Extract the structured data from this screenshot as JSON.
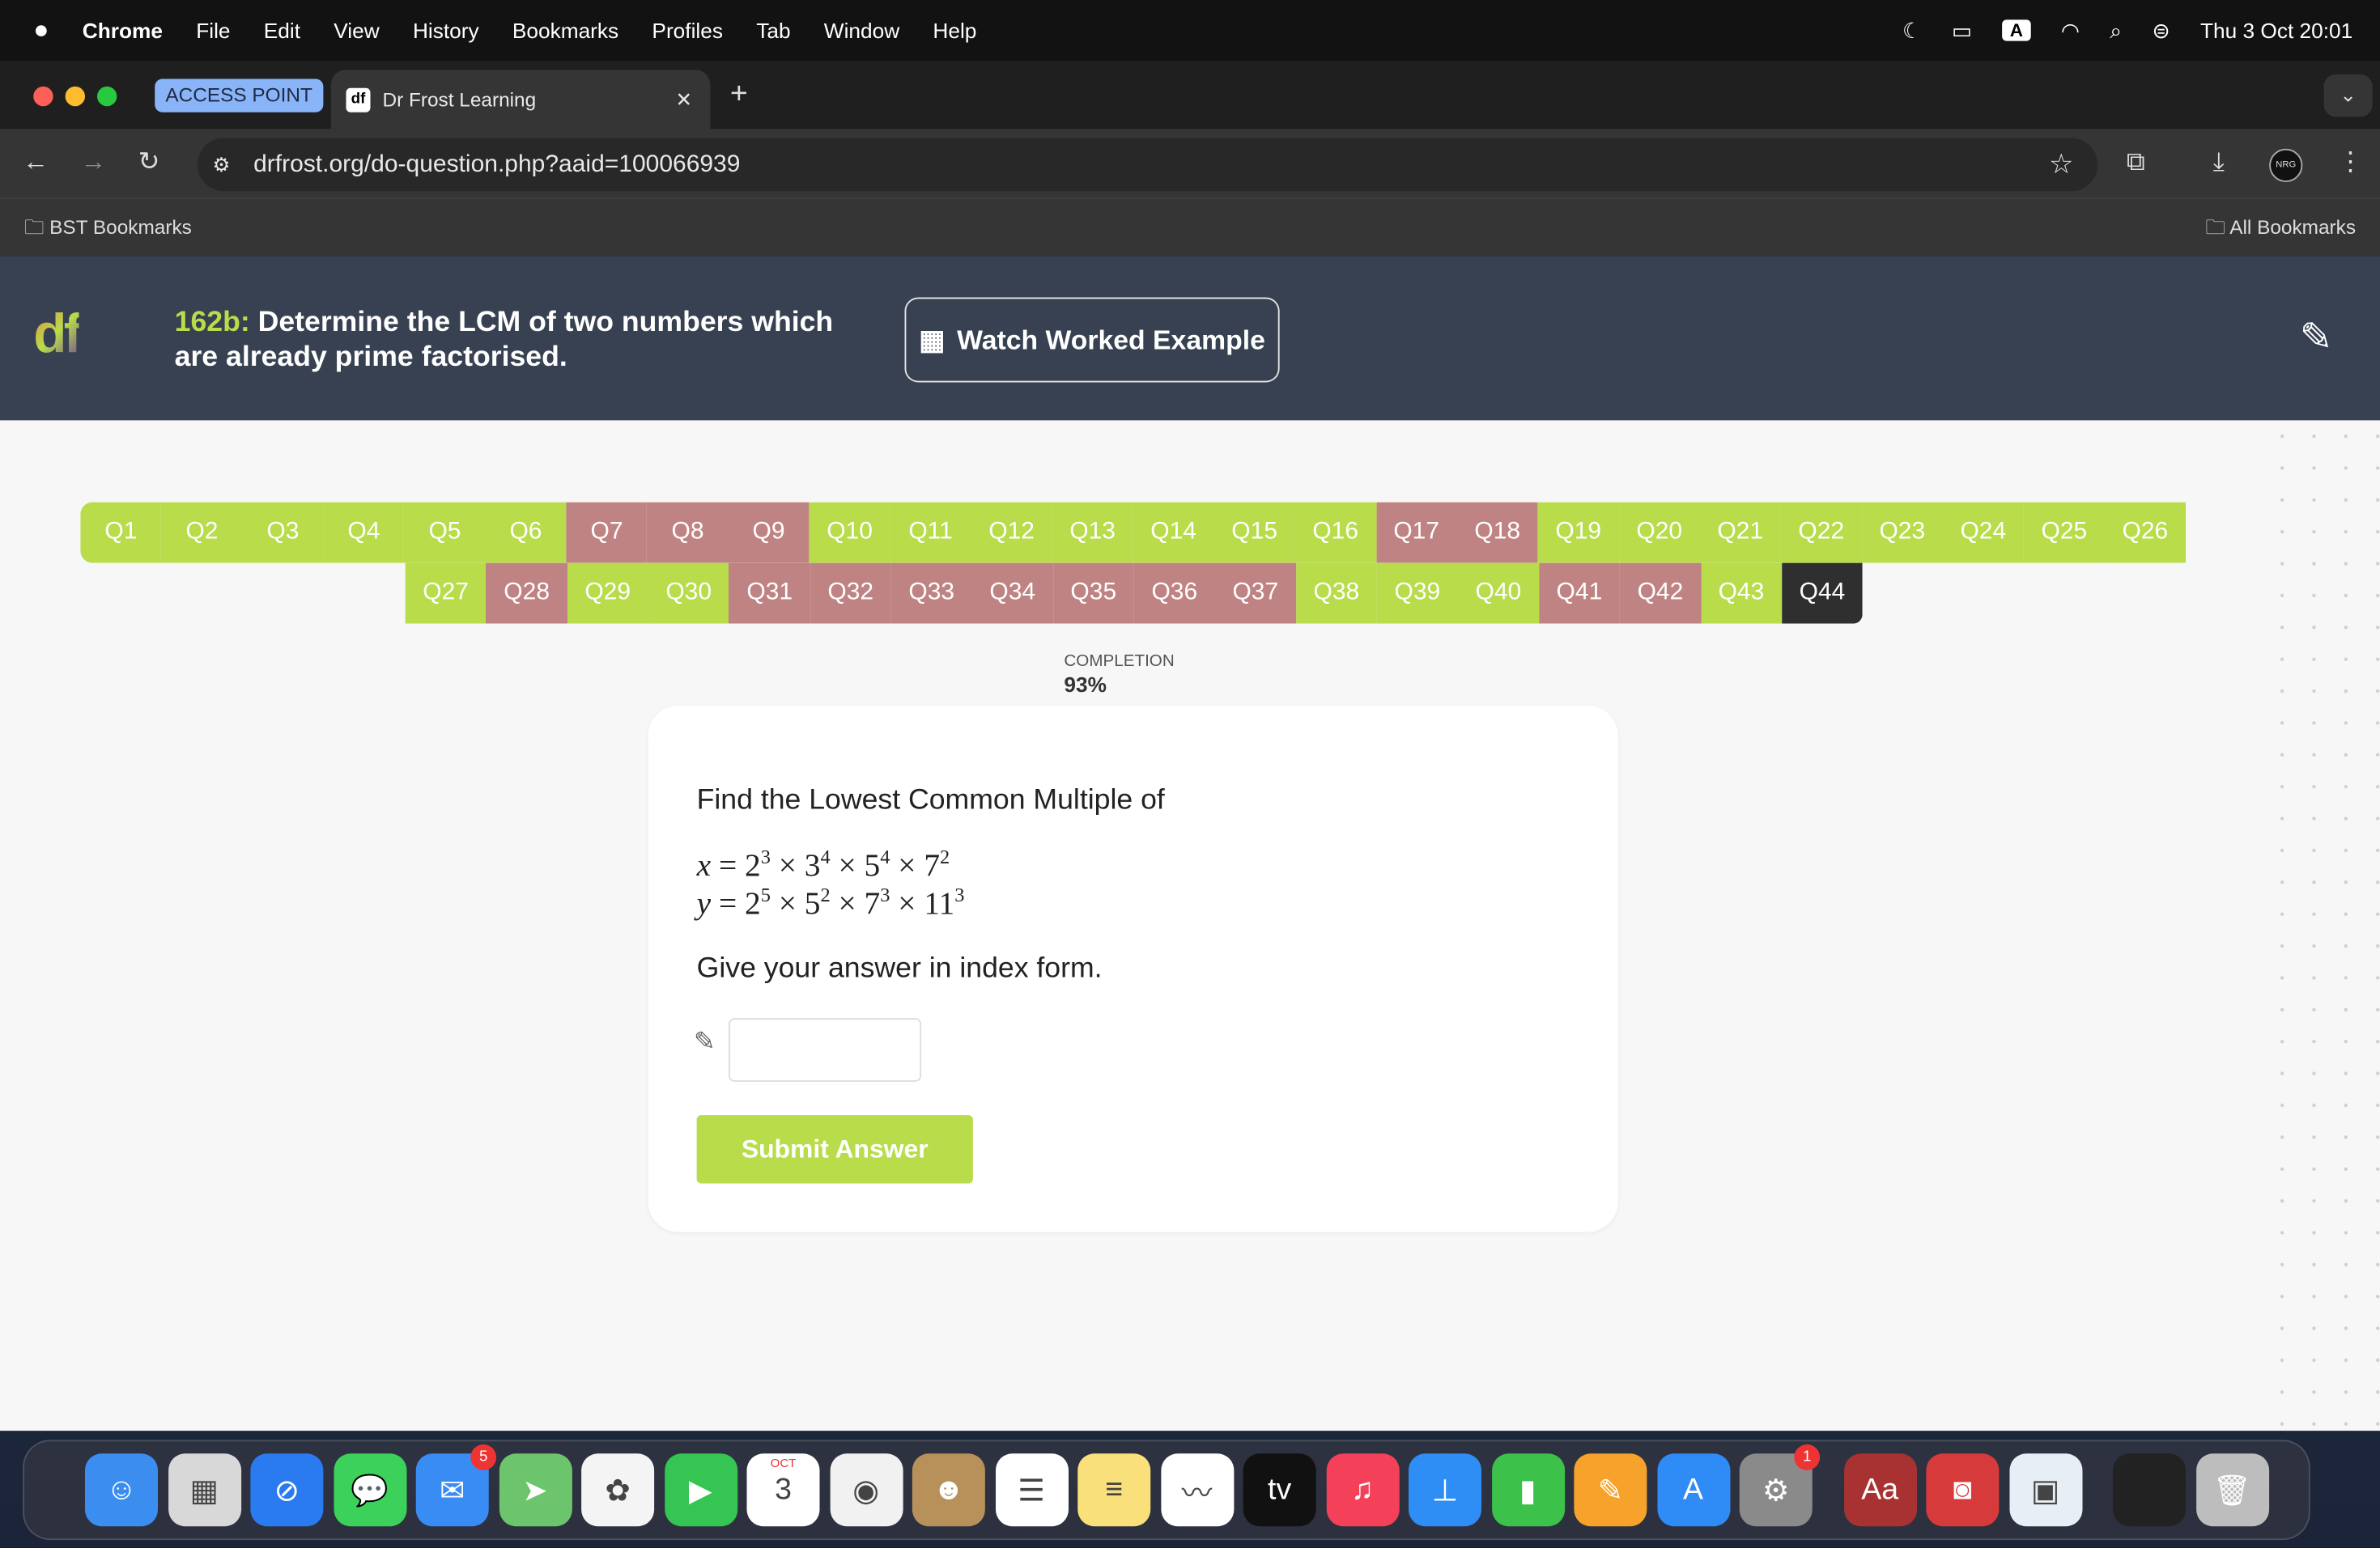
{
  "menubar": {
    "app": "Chrome",
    "items": [
      "File",
      "Edit",
      "View",
      "History",
      "Bookmarks",
      "Profiles",
      "Tab",
      "Window",
      "Help"
    ],
    "datetime": "Thu 3 Oct  20:01",
    "input_source": "A"
  },
  "browser": {
    "group_label": "ACCESS POINT",
    "tab_title": "Dr Frost Learning",
    "tab_favicon": "df",
    "url": "drfrost.org/do-question.php?aaid=100066939",
    "bookmarks_left": "BST Bookmarks",
    "bookmarks_right": "All Bookmarks",
    "profile": "NRG"
  },
  "header": {
    "code": "162b:",
    "title": "Determine the LCM of two numbers which are already prime factorised.",
    "worked_example": "Watch Worked Example"
  },
  "questions": {
    "row1": [
      {
        "l": "Q1",
        "s": "g"
      },
      {
        "l": "Q2",
        "s": "g"
      },
      {
        "l": "Q3",
        "s": "g"
      },
      {
        "l": "Q4",
        "s": "g"
      },
      {
        "l": "Q5",
        "s": "g"
      },
      {
        "l": "Q6",
        "s": "g"
      },
      {
        "l": "Q7",
        "s": "r"
      },
      {
        "l": "Q8",
        "s": "r"
      },
      {
        "l": "Q9",
        "s": "r"
      },
      {
        "l": "Q10",
        "s": "g"
      },
      {
        "l": "Q11",
        "s": "g"
      },
      {
        "l": "Q12",
        "s": "g"
      },
      {
        "l": "Q13",
        "s": "g"
      },
      {
        "l": "Q14",
        "s": "g"
      },
      {
        "l": "Q15",
        "s": "g"
      },
      {
        "l": "Q16",
        "s": "g"
      },
      {
        "l": "Q17",
        "s": "r"
      },
      {
        "l": "Q18",
        "s": "r"
      },
      {
        "l": "Q19",
        "s": "g"
      },
      {
        "l": "Q20",
        "s": "g"
      },
      {
        "l": "Q21",
        "s": "g"
      },
      {
        "l": "Q22",
        "s": "g"
      },
      {
        "l": "Q23",
        "s": "g"
      },
      {
        "l": "Q24",
        "s": "g"
      },
      {
        "l": "Q25",
        "s": "g"
      },
      {
        "l": "Q26",
        "s": "g"
      }
    ],
    "row2": [
      {
        "l": "Q27",
        "s": "g"
      },
      {
        "l": "Q28",
        "s": "r"
      },
      {
        "l": "Q29",
        "s": "g"
      },
      {
        "l": "Q30",
        "s": "g"
      },
      {
        "l": "Q31",
        "s": "r"
      },
      {
        "l": "Q32",
        "s": "r"
      },
      {
        "l": "Q33",
        "s": "r"
      },
      {
        "l": "Q34",
        "s": "r"
      },
      {
        "l": "Q35",
        "s": "r"
      },
      {
        "l": "Q36",
        "s": "r"
      },
      {
        "l": "Q37",
        "s": "r"
      },
      {
        "l": "Q38",
        "s": "g"
      },
      {
        "l": "Q39",
        "s": "g"
      },
      {
        "l": "Q40",
        "s": "g"
      },
      {
        "l": "Q41",
        "s": "r"
      },
      {
        "l": "Q42",
        "s": "r"
      },
      {
        "l": "Q43",
        "s": "g"
      },
      {
        "l": "Q44",
        "s": "c"
      }
    ],
    "colors": {
      "correct": "#b8dc4a",
      "incorrect": "#c08383",
      "current": "#2f2f2f"
    }
  },
  "completion": {
    "label": "COMPLETION",
    "value": "93%"
  },
  "question": {
    "prompt": "Find the Lowest Common Multiple of",
    "x_var": "x",
    "y_var": "y",
    "x_factors": [
      [
        "2",
        "3"
      ],
      [
        "3",
        "4"
      ],
      [
        "5",
        "4"
      ],
      [
        "7",
        "2"
      ]
    ],
    "y_factors": [
      [
        "2",
        "5"
      ],
      [
        "5",
        "2"
      ],
      [
        "7",
        "3"
      ],
      [
        "11",
        "3"
      ]
    ],
    "instruction": "Give your answer in index form.",
    "answer_value": "",
    "submit": "Submit Answer"
  },
  "dock": [
    {
      "n": "finder",
      "c": "#3b8ef0",
      "g": "☺"
    },
    {
      "n": "launchpad",
      "c": "#d8d8d8",
      "g": "▦"
    },
    {
      "n": "safari",
      "c": "#2a7bf0",
      "g": "⊘"
    },
    {
      "n": "messages",
      "c": "#3bd15a",
      "g": "💬"
    },
    {
      "n": "mail",
      "c": "#3a8cf5",
      "g": "✉",
      "b": "5"
    },
    {
      "n": "maps",
      "c": "#6cc46c",
      "g": "➤"
    },
    {
      "n": "photos",
      "c": "#f4f4f4",
      "g": "✿"
    },
    {
      "n": "facetime",
      "c": "#35c552",
      "g": "▶"
    },
    {
      "n": "calendar",
      "c": "#ffffff",
      "g": "3",
      "sub": "OCT"
    },
    {
      "n": "chrome",
      "c": "#f1f1f1",
      "g": "◉"
    },
    {
      "n": "contacts",
      "c": "#b8905a",
      "g": "☻"
    },
    {
      "n": "reminders",
      "c": "#ffffff",
      "g": "☰"
    },
    {
      "n": "notes",
      "c": "#f9e07a",
      "g": "≡"
    },
    {
      "n": "freeform",
      "c": "#ffffff",
      "g": "〰"
    },
    {
      "n": "tv",
      "c": "#111111",
      "g": "tv"
    },
    {
      "n": "music",
      "c": "#f5405a",
      "g": "♫"
    },
    {
      "n": "keynote",
      "c": "#2e8ef5",
      "g": "⊥"
    },
    {
      "n": "numbers",
      "c": "#3cc24b",
      "g": "▮"
    },
    {
      "n": "pages",
      "c": "#f6a22b",
      "g": "✎"
    },
    {
      "n": "app-store",
      "c": "#2f8bf5",
      "g": "A"
    },
    {
      "n": "system-settings",
      "c": "#8a8a8a",
      "g": "⚙",
      "b": "1"
    },
    {
      "n": "dictionary",
      "c": "#a83232",
      "g": "Aa"
    },
    {
      "n": "photo-booth",
      "c": "#d63a3a",
      "g": "◙"
    },
    {
      "n": "preview",
      "c": "#e8eef5",
      "g": "▣"
    },
    {
      "n": "window",
      "c": "#222222",
      "g": ""
    },
    {
      "n": "trash",
      "c": "#bdbdbd",
      "g": "🗑"
    }
  ]
}
